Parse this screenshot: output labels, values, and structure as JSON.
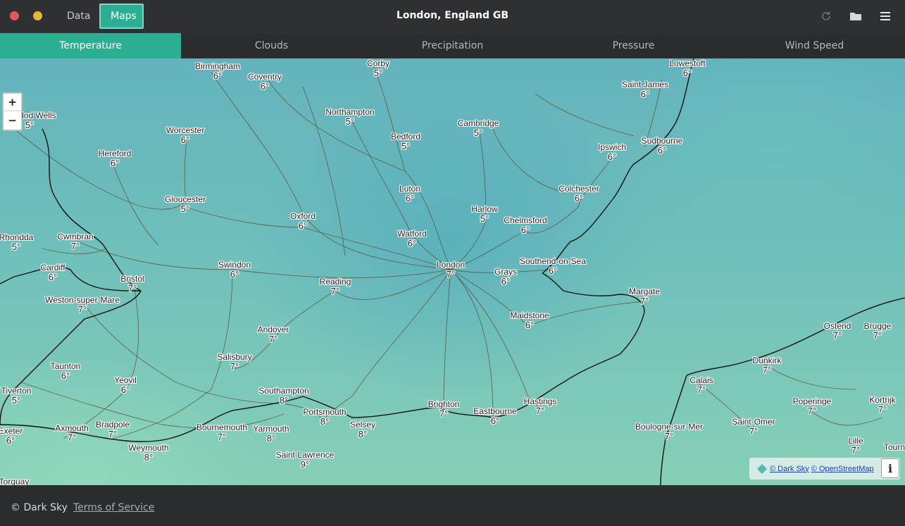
{
  "window": {
    "title": "London, England GB"
  },
  "nav": {
    "data_label": "Data",
    "maps_label": "Maps"
  },
  "tabs": [
    {
      "label": "Temperature",
      "active": true
    },
    {
      "label": "Clouds",
      "active": false
    },
    {
      "label": "Precipitation",
      "active": false
    },
    {
      "label": "Pressure",
      "active": false
    },
    {
      "label": "Wind Speed",
      "active": false
    }
  ],
  "toolbar": {
    "icons": [
      "refresh-icon",
      "folder-icon",
      "menu-icon"
    ]
  },
  "map": {
    "zoom_in": "+",
    "zoom_out": "−",
    "attribution": {
      "darksky": "© Dark Sky",
      "osm": "© OpenStreetMap"
    },
    "info": "i",
    "cities": [
      {
        "name": "Birmingham",
        "temp": "6°"
      },
      {
        "name": "Coventry",
        "temp": "6°"
      },
      {
        "name": "Corby",
        "temp": "5°"
      },
      {
        "name": "Lowestoft",
        "temp": "6°"
      },
      {
        "name": "Saint James",
        "temp": "6°"
      },
      {
        "name": "Llandod Wells",
        "temp": "5°"
      },
      {
        "name": "Northampton",
        "temp": "5°"
      },
      {
        "name": "Cambridge",
        "temp": "5°"
      },
      {
        "name": "Worcester",
        "temp": "6°"
      },
      {
        "name": "Bedford",
        "temp": "5°"
      },
      {
        "name": "Ipswich",
        "temp": "6°"
      },
      {
        "name": "Sudbourne",
        "temp": "6°"
      },
      {
        "name": "Hereford",
        "temp": "6°"
      },
      {
        "name": "Luton",
        "temp": "6°"
      },
      {
        "name": "Colchester",
        "temp": "6°"
      },
      {
        "name": "Gloucester",
        "temp": "5°"
      },
      {
        "name": "Harlow",
        "temp": "5°"
      },
      {
        "name": "Oxford",
        "temp": "6°"
      },
      {
        "name": "Chelmsford",
        "temp": "6°"
      },
      {
        "name": "Watford",
        "temp": "6°"
      },
      {
        "name": "Rhondda",
        "temp": "5°"
      },
      {
        "name": "Cwmbran",
        "temp": "7°"
      },
      {
        "name": "Southend-on-Sea",
        "temp": "6°"
      },
      {
        "name": "Swindon",
        "temp": "6°"
      },
      {
        "name": "London",
        "temp": "7°"
      },
      {
        "name": "Cardiff",
        "temp": "6°"
      },
      {
        "name": "Grays",
        "temp": "6°"
      },
      {
        "name": "Bristol",
        "temp": "7°"
      },
      {
        "name": "Reading",
        "temp": "7°"
      },
      {
        "name": "Margate",
        "temp": "7°"
      },
      {
        "name": "Weston-super-Mare",
        "temp": "7°"
      },
      {
        "name": "Maidstone",
        "temp": "6°"
      },
      {
        "name": "Andover",
        "temp": "7°"
      },
      {
        "name": "Ostend",
        "temp": "7°"
      },
      {
        "name": "Brugge",
        "temp": "7°"
      },
      {
        "name": "Salisbury",
        "temp": "7°"
      },
      {
        "name": "Dunkirk",
        "temp": "7°"
      },
      {
        "name": "Taunton",
        "temp": "6°"
      },
      {
        "name": "Yeovil",
        "temp": "6°"
      },
      {
        "name": "Calais",
        "temp": "7°"
      },
      {
        "name": "Southampton",
        "temp": "8°"
      },
      {
        "name": "Tiverton",
        "temp": "5°"
      },
      {
        "name": "Brighton",
        "temp": "7°"
      },
      {
        "name": "Hastings",
        "temp": "7°"
      },
      {
        "name": "Poperinge",
        "temp": "7°"
      },
      {
        "name": "Kortrijk",
        "temp": "7°"
      },
      {
        "name": "Portsmouth",
        "temp": "8°"
      },
      {
        "name": "Eastbourne",
        "temp": "6°"
      },
      {
        "name": "Bradpole",
        "temp": "7°"
      },
      {
        "name": "Selsey",
        "temp": "8°"
      },
      {
        "name": "Axmouth",
        "temp": "7°"
      },
      {
        "name": "Bournemouth",
        "temp": "7°"
      },
      {
        "name": "Yarmouth",
        "temp": "8°"
      },
      {
        "name": "Saint-Omer",
        "temp": "7°"
      },
      {
        "name": "Boulogne-sur-Mer",
        "temp": "7°"
      },
      {
        "name": "Exeter",
        "temp": "6°"
      },
      {
        "name": "Lille",
        "temp": "7°"
      },
      {
        "name": "Weymouth",
        "temp": "8°"
      },
      {
        "name": "Saint Lawrence",
        "temp": "9°"
      },
      {
        "name": "Tourn",
        "temp": ""
      },
      {
        "name": "Torquay",
        "temp": ""
      }
    ]
  },
  "footer": {
    "copyright": "© Dark Sky",
    "terms": "Terms of Service"
  },
  "colors": {
    "accent": "#2cae93",
    "titlebar": "#2f3033",
    "background": "#2b2c2e",
    "close": "#e4575a",
    "minimize": "#e7b637"
  }
}
